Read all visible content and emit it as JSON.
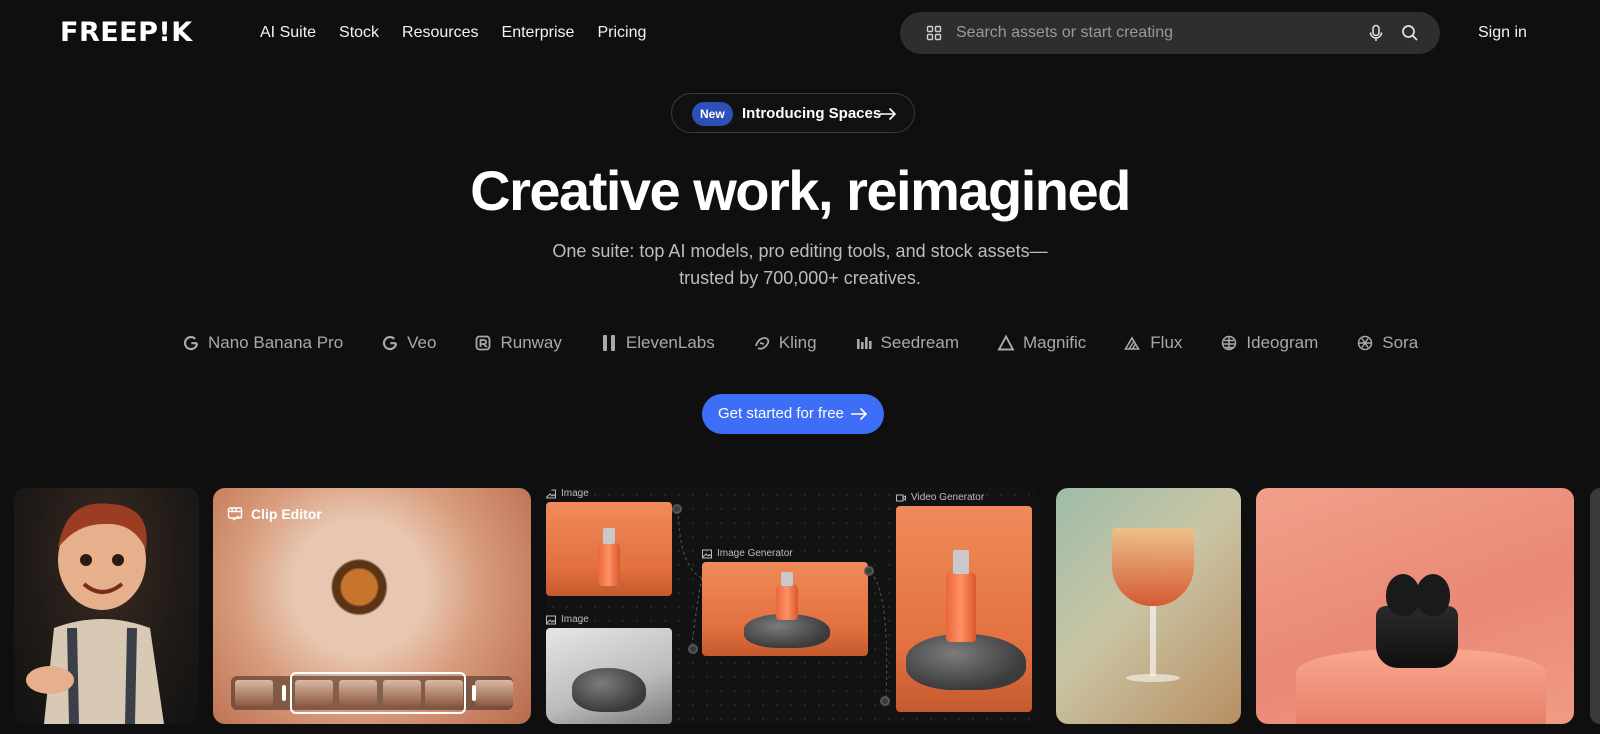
{
  "header": {
    "logo": "FREEP!K",
    "nav": [
      "AI Suite",
      "Stock",
      "Resources",
      "Enterprise",
      "Pricing"
    ],
    "search_placeholder": "Search assets or start creating",
    "signin": "Sign in"
  },
  "hero": {
    "badge": "New",
    "announcement": "Introducing Spaces",
    "title": "Creative work, reimagined",
    "subtitle_line1": "One suite: top AI models, pro editing tools, and stock assets—",
    "subtitle_line2": "trusted by 700,000+ creatives.",
    "cta": "Get started for free"
  },
  "models": [
    {
      "name": "Nano Banana Pro",
      "icon": "google-g-icon"
    },
    {
      "name": "Veo",
      "icon": "google-g-icon"
    },
    {
      "name": "Runway",
      "icon": "runway-icon"
    },
    {
      "name": "ElevenLabs",
      "icon": "elevenlabs-icon"
    },
    {
      "name": "Kling",
      "icon": "kling-icon"
    },
    {
      "name": "Seedream",
      "icon": "seedream-icon"
    },
    {
      "name": "Magnific",
      "icon": "magnific-icon"
    },
    {
      "name": "Flux",
      "icon": "flux-icon"
    },
    {
      "name": "Ideogram",
      "icon": "ideogram-icon"
    },
    {
      "name": "Sora",
      "icon": "sora-icon"
    }
  ],
  "gallery": {
    "clip_editor_label": "Clip Editor",
    "workflow": {
      "image_label_1": "Image",
      "image_label_2": "Image",
      "image_generator_label": "Image Generator",
      "video_generator_label": "Video Generator"
    }
  },
  "colors": {
    "background": "#0f0f0f",
    "accent": "#3d6ef5",
    "badge": "#2c4fb8",
    "search_bg": "#2e2e2e"
  }
}
